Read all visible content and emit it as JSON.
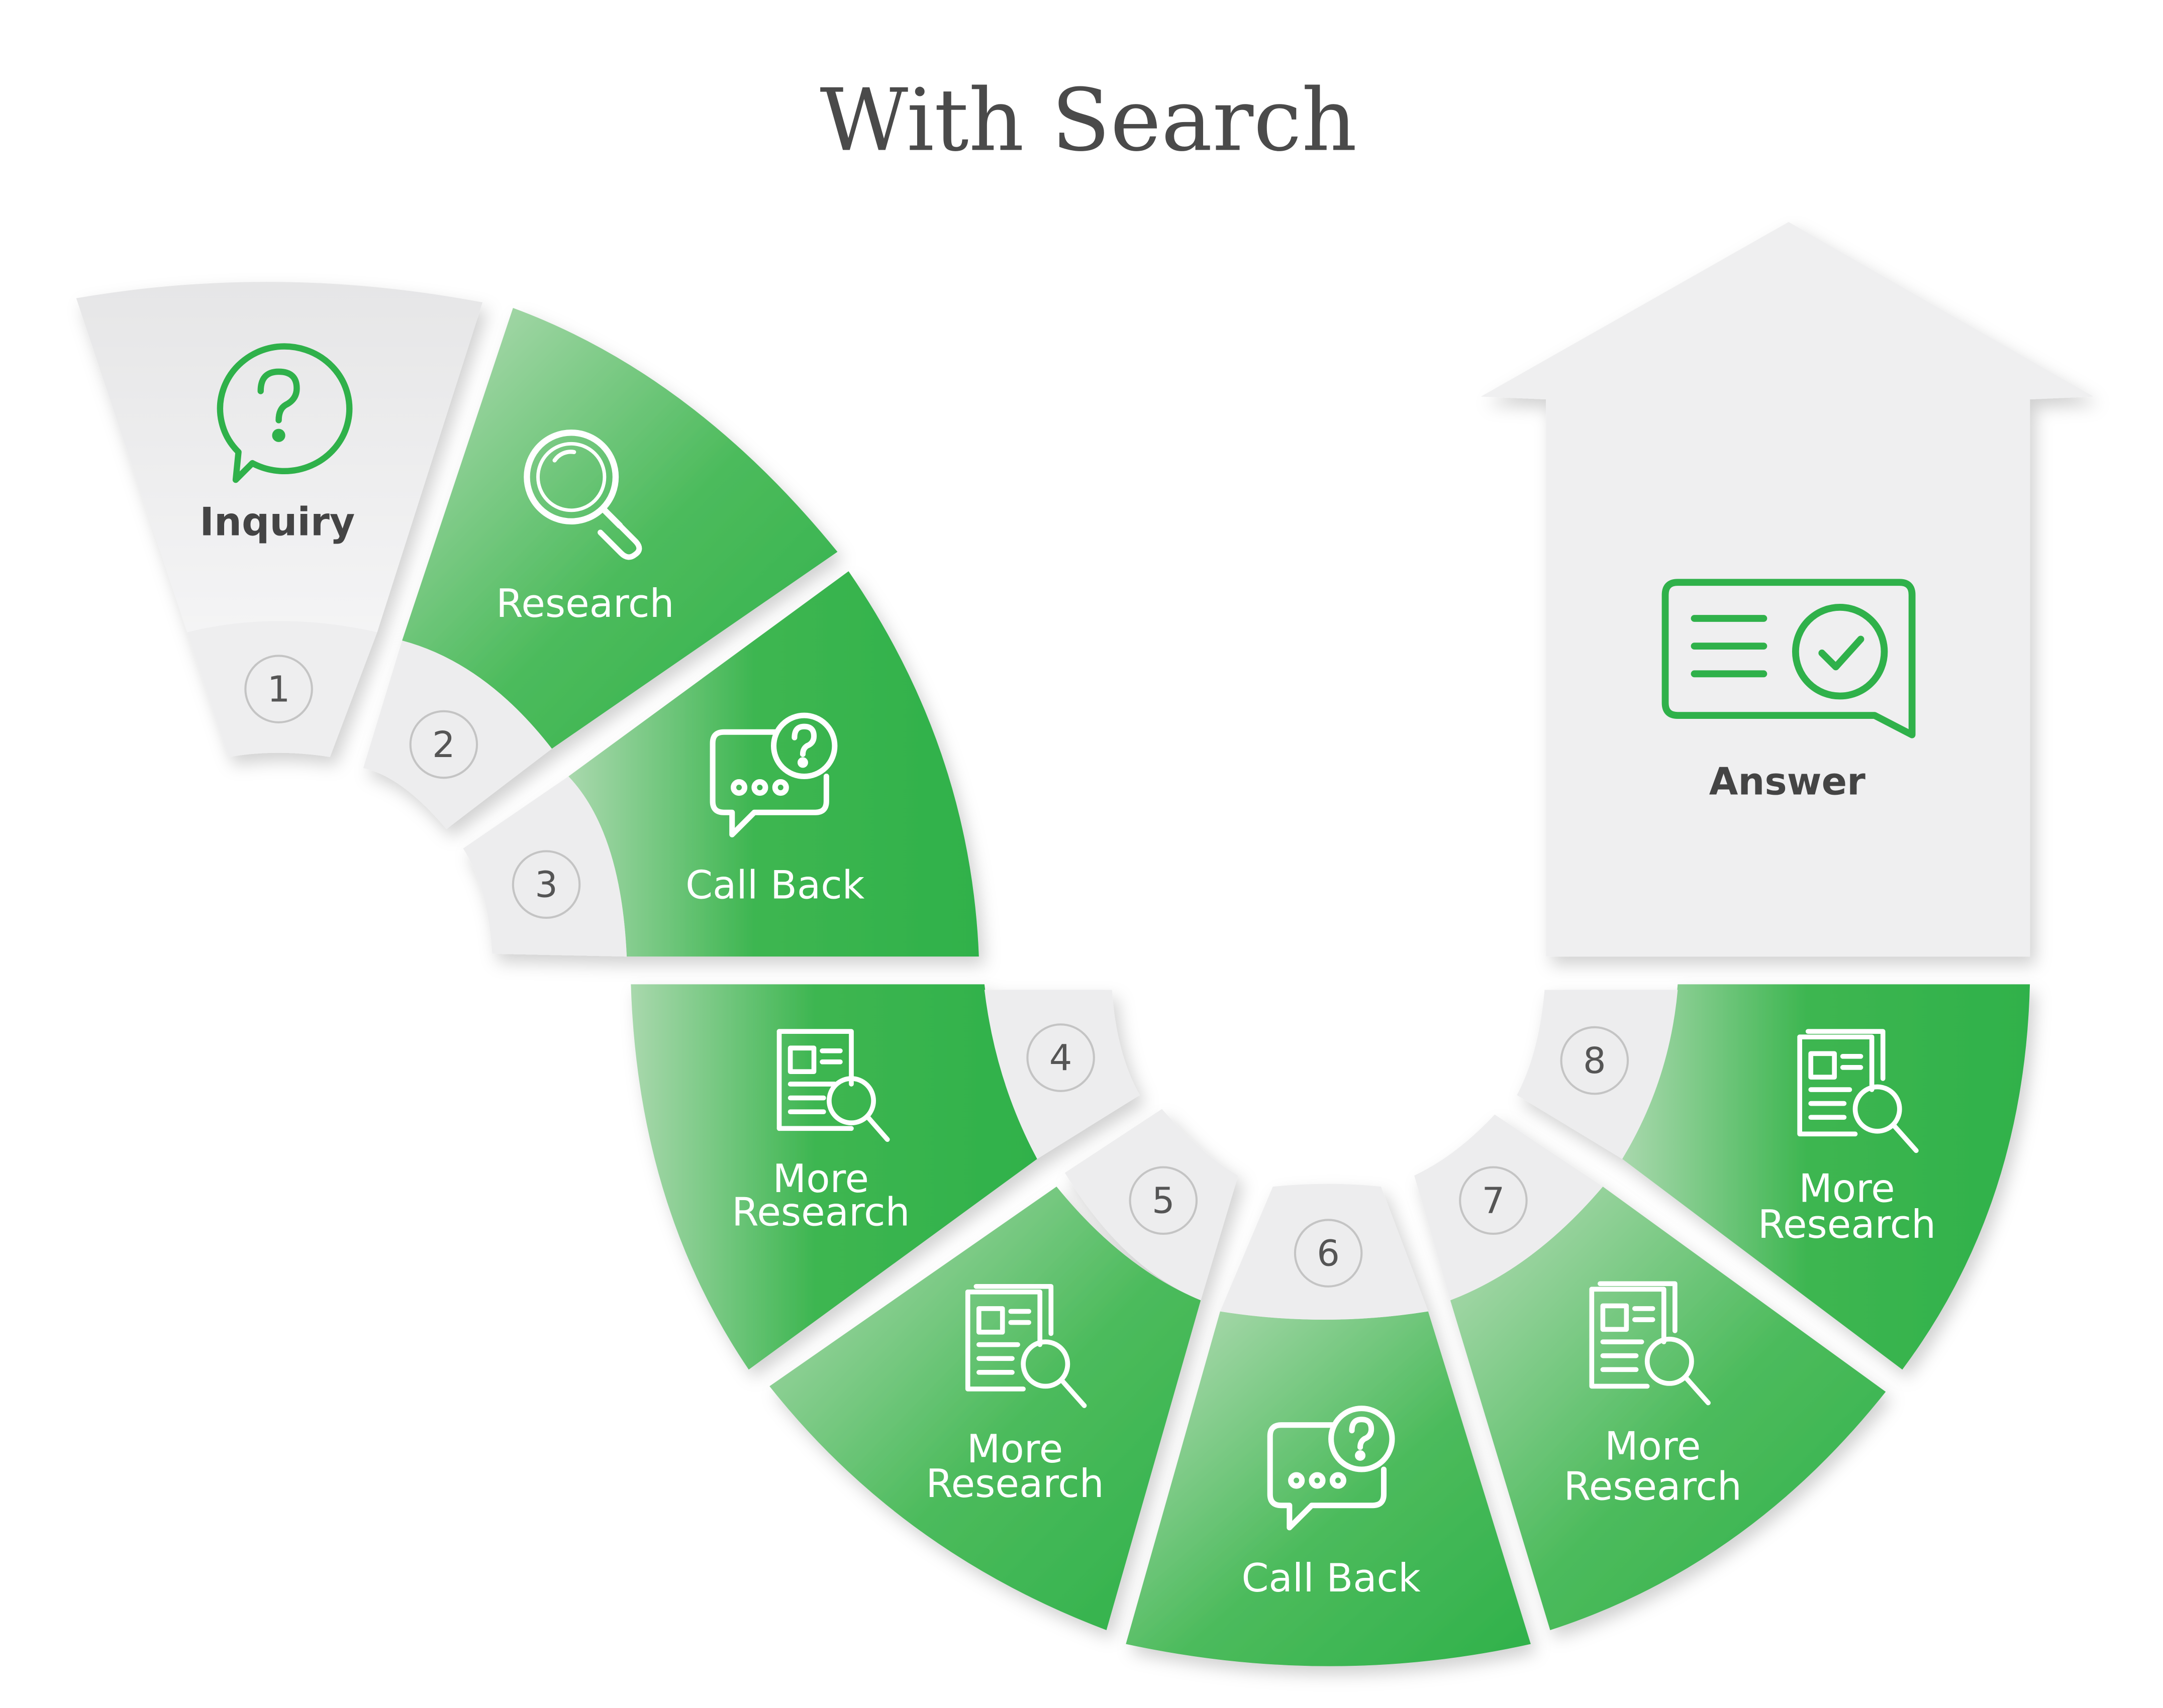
{
  "title": "With Search",
  "colors": {
    "green": "#2fb14a",
    "green_light": "#a9d8ad",
    "gray_panel": "#eeeeef",
    "gray_border": "#c9c9c9",
    "text_dark": "#444444",
    "text_white": "#ffffff"
  },
  "steps": [
    {
      "number": "1",
      "label_lines": [
        "Inquiry"
      ],
      "icon": "question-bubble-icon",
      "style": "gray"
    },
    {
      "number": "2",
      "label_lines": [
        "Research"
      ],
      "icon": "magnifier-icon",
      "style": "green"
    },
    {
      "number": "3",
      "label_lines": [
        "Call Back"
      ],
      "icon": "chat-question-icon",
      "style": "green"
    },
    {
      "number": "4",
      "label_lines": [
        "More",
        "Research"
      ],
      "icon": "document-search-icon",
      "style": "green"
    },
    {
      "number": "5",
      "label_lines": [
        "More",
        "Research"
      ],
      "icon": "document-search-icon",
      "style": "green"
    },
    {
      "number": "6",
      "label_lines": [
        "Call Back"
      ],
      "icon": "chat-question-icon",
      "style": "green"
    },
    {
      "number": "7",
      "label_lines": [
        "More",
        "Research"
      ],
      "icon": "document-search-icon",
      "style": "green"
    },
    {
      "number": "8",
      "label_lines": [
        "More",
        "Research"
      ],
      "icon": "document-search-icon",
      "style": "green"
    }
  ],
  "answer": {
    "label": "Answer",
    "icon": "answer-check-icon"
  }
}
